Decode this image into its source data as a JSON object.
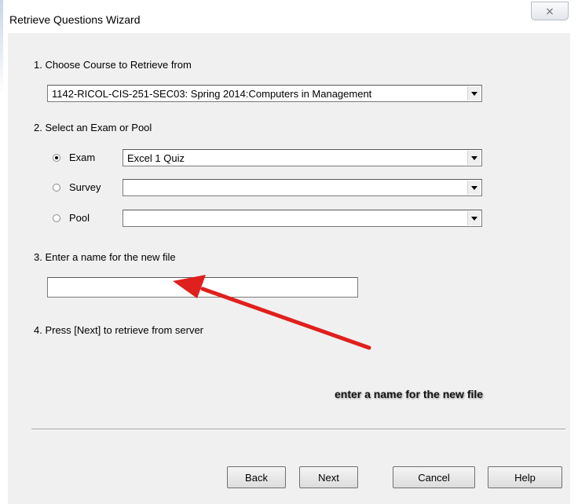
{
  "window": {
    "title": "Retrieve Questions Wizard",
    "close_icon": "close-icon"
  },
  "step1": {
    "label": "1. Choose Course to Retrieve from",
    "course_value": "1142-RICOL-CIS-251-SEC03: Spring 2014:Computers in Management"
  },
  "step2": {
    "label": "2. Select an Exam or Pool",
    "options": [
      {
        "label": "Exam",
        "selected": true,
        "value": "Excel 1 Quiz"
      },
      {
        "label": "Survey",
        "selected": false,
        "value": ""
      },
      {
        "label": "Pool",
        "selected": false,
        "value": ""
      }
    ]
  },
  "step3": {
    "label": "3. Enter a name for the new file",
    "file_name_value": ""
  },
  "step4": {
    "label": "4. Press [Next] to retrieve from server"
  },
  "buttons": {
    "back": "Back",
    "next": "Next",
    "cancel": "Cancel",
    "help": "Help"
  },
  "annotation": {
    "text": "enter a name for the new file",
    "arrow_color": "#e0201c"
  }
}
